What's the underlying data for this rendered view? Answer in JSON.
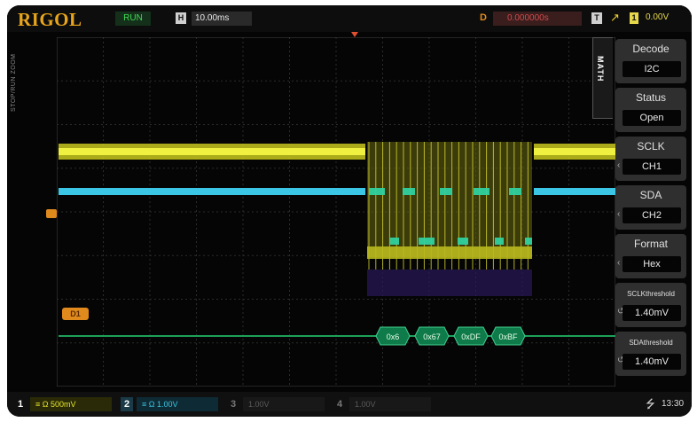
{
  "brand": "RIGOL",
  "status": {
    "run_label": "RUN",
    "h_icon": "H",
    "timebase": "10.00ms"
  },
  "trigger": {
    "delay_icon": "D",
    "delay": "0.000000s",
    "t_icon": "T",
    "edge_icon": "rising-edge-icon",
    "source": "1",
    "level": "0.00V"
  },
  "side_label": "STOP/RUN ZOOM",
  "menu": {
    "tab": "MATH",
    "items": [
      {
        "title": "Decode",
        "value": "I2C"
      },
      {
        "title": "Status",
        "value": "Open"
      },
      {
        "title": "SCLK",
        "value": "CH1"
      },
      {
        "title": "SDA",
        "value": "CH2"
      },
      {
        "title": "Format",
        "value": "Hex"
      },
      {
        "title": "SCLKthreshold",
        "value": "1.40mV"
      },
      {
        "title": "SDAthreshold",
        "value": "1.40mV"
      }
    ]
  },
  "decode": {
    "label": "D1",
    "packets": [
      "0x6",
      "0x67",
      "0xDF",
      "0xBF"
    ]
  },
  "channels": [
    {
      "num": "1",
      "scale": "500mV",
      "color": "#e6e62a"
    },
    {
      "num": "2",
      "scale": "1.00V",
      "color": "#3cc6e6"
    },
    {
      "num": "3",
      "scale": "1.00V",
      "color": "#d050d0"
    },
    {
      "num": "4",
      "scale": "1.00V",
      "color": "#3070e0"
    }
  ],
  "clock": "13:30",
  "colors": {
    "ch1": "#e6e62a",
    "ch2": "#3cc6e6",
    "decode": "#1fa058",
    "accent": "#e08a1e"
  }
}
